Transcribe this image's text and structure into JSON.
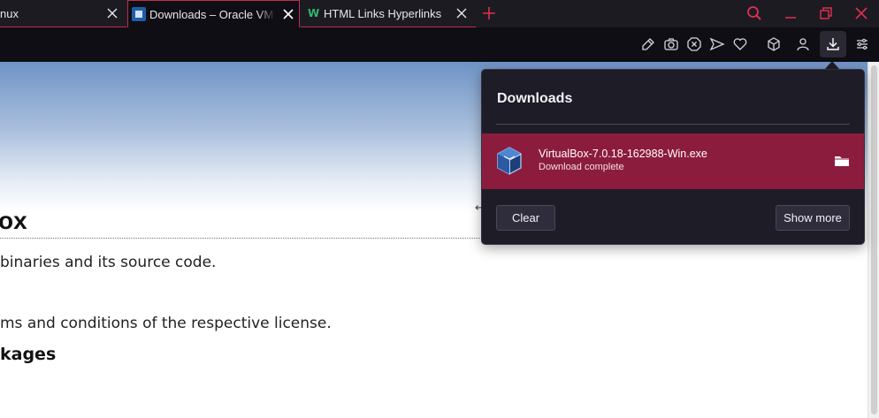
{
  "tabs": [
    {
      "title": "nux",
      "active": false
    },
    {
      "title": "Downloads – Oracle VM VirtualBox",
      "active": true
    },
    {
      "title": "HTML Links Hyperlinks",
      "active": false
    }
  ],
  "page": {
    "heading": "ox",
    "paragraph_1": "binaries and its source code.",
    "paragraph_2": "ms and conditions of the respective license.",
    "subheading": "kages",
    "arrow_glyph": "↵"
  },
  "downloads_panel": {
    "title": "Downloads",
    "item": {
      "filename": "VirtualBox-7.0.18-162988-Win.exe",
      "status": "Download complete"
    },
    "clear_label": "Clear",
    "show_more_label": "Show more"
  },
  "colors": {
    "accent": "#c0304c",
    "download_item_bg": "#8c1c3e",
    "panel_bg": "#1e1c27",
    "toolbar_bg": "#0f0e14"
  }
}
